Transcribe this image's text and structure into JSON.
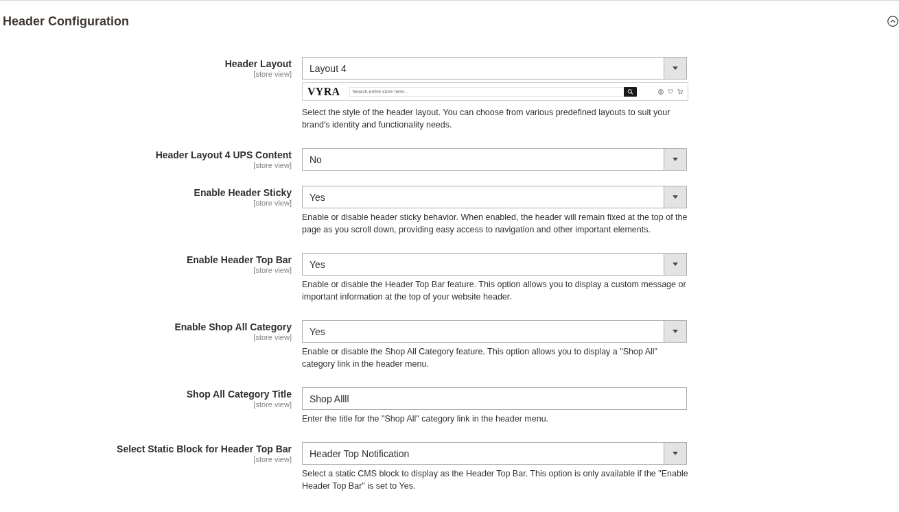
{
  "section": {
    "title": "Header Configuration",
    "expanded": true
  },
  "fields": [
    {
      "kind": "select",
      "label": "Header Layout",
      "scope": "[store view]",
      "value": "Layout 4",
      "preview": {
        "logo": "VYRA",
        "search_placeholder": "Search entire store here..."
      },
      "note": "Select the style of the header layout. You can choose from various predefined layouts to suit your brand's identity and functionality needs."
    },
    {
      "kind": "select",
      "label": "Header Layout 4 UPS Content",
      "scope": "[store view]",
      "value": "No"
    },
    {
      "kind": "select",
      "label": "Enable Header Sticky",
      "scope": "[store view]",
      "value": "Yes",
      "note": "Enable or disable header sticky behavior. When enabled, the header will remain fixed at the top of the page as you scroll down, providing easy access to navigation and other important elements."
    },
    {
      "kind": "select",
      "label": "Enable Header Top Bar",
      "scope": "[store view]",
      "value": "Yes",
      "note": "Enable or disable the Header Top Bar feature. This option allows you to display a custom message or important information at the top of your website header."
    },
    {
      "kind": "select",
      "label": "Enable Shop All Category",
      "scope": "[store view]",
      "value": "Yes",
      "note": "Enable or disable the Shop All Category feature. This option allows you to display a \"Shop All\" category link in the header menu."
    },
    {
      "kind": "text",
      "label": "Shop All Category Title",
      "scope": "[store view]",
      "value": "Shop Allll",
      "note": "Enter the title for the \"Shop All\" category link in the header menu."
    },
    {
      "kind": "select",
      "label": "Select Static Block for Header Top Bar",
      "scope": "[store view]",
      "value": "Header Top Notification",
      "note": "Select a static CMS block to display as the Header Top Bar. This option is only available if the \"Enable Header Top Bar\" is set to Yes."
    }
  ]
}
